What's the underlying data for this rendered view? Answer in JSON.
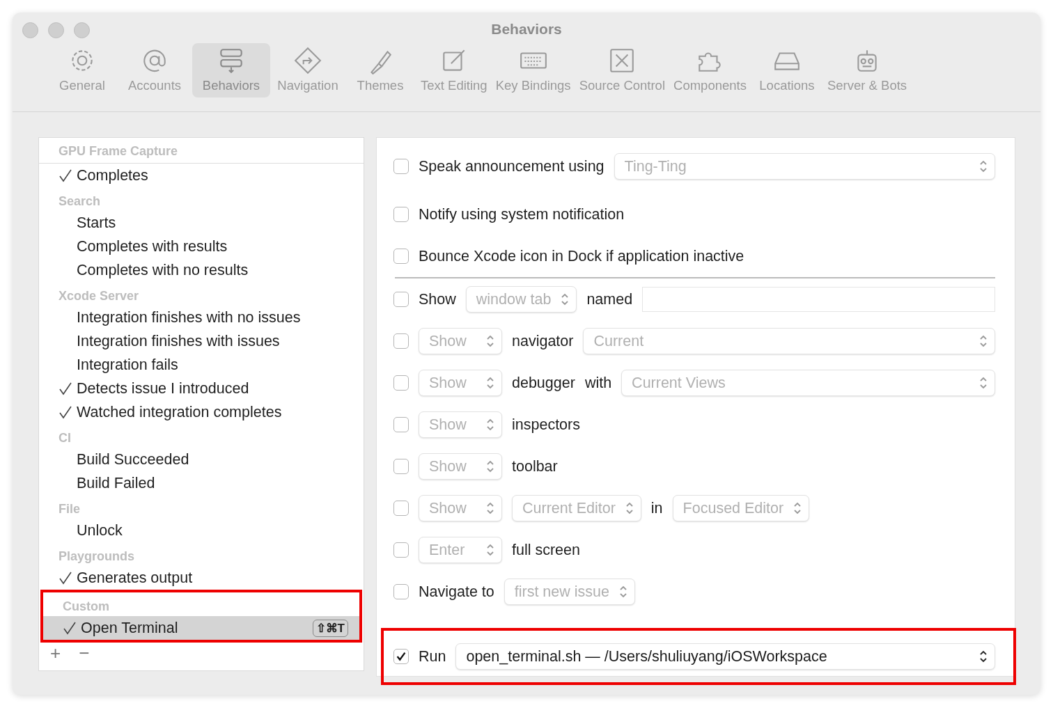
{
  "window": {
    "title": "Behaviors"
  },
  "toolbar": [
    {
      "label": "General",
      "selected": false
    },
    {
      "label": "Accounts",
      "selected": false
    },
    {
      "label": "Behaviors",
      "selected": true
    },
    {
      "label": "Navigation",
      "selected": false
    },
    {
      "label": "Themes",
      "selected": false
    },
    {
      "label": "Text Editing",
      "selected": false
    },
    {
      "label": "Key Bindings",
      "selected": false
    },
    {
      "label": "Source Control",
      "selected": false
    },
    {
      "label": "Components",
      "selected": false
    },
    {
      "label": "Locations",
      "selected": false
    },
    {
      "label": "Server & Bots",
      "selected": false
    }
  ],
  "sidebar": {
    "groups": [
      {
        "header": "GPU Frame Capture",
        "items": [
          {
            "label": "Completes",
            "checked": true,
            "selected": false
          }
        ]
      },
      {
        "header": "Search",
        "items": [
          {
            "label": "Starts",
            "checked": false,
            "selected": false
          },
          {
            "label": "Completes with results",
            "checked": false,
            "selected": false
          },
          {
            "label": "Completes with no results",
            "checked": false,
            "selected": false
          }
        ]
      },
      {
        "header": "Xcode Server",
        "items": [
          {
            "label": "Integration finishes with no issues",
            "checked": false,
            "selected": false
          },
          {
            "label": "Integration finishes with issues",
            "checked": false,
            "selected": false
          },
          {
            "label": "Integration fails",
            "checked": false,
            "selected": false
          },
          {
            "label": "Detects issue I introduced",
            "checked": true,
            "selected": false
          },
          {
            "label": "Watched integration completes",
            "checked": true,
            "selected": false
          }
        ]
      },
      {
        "header": "CI",
        "items": [
          {
            "label": "Build Succeeded",
            "checked": false,
            "selected": false
          },
          {
            "label": "Build Failed",
            "checked": false,
            "selected": false
          }
        ]
      },
      {
        "header": "File",
        "items": [
          {
            "label": "Unlock",
            "checked": false,
            "selected": false
          }
        ]
      },
      {
        "header": "Playgrounds",
        "items": [
          {
            "label": "Generates output",
            "checked": true,
            "selected": false
          }
        ]
      },
      {
        "header": "Custom",
        "highlighted": true,
        "items": [
          {
            "label": "Open Terminal",
            "checked": true,
            "selected": true,
            "shortcut": "⇧⌘T"
          }
        ]
      }
    ],
    "footer": [
      "+",
      "−"
    ]
  },
  "settings": {
    "rows": [
      {
        "checked": false,
        "parts": [
          {
            "kind": "label",
            "text": "Speak announcement using"
          },
          {
            "kind": "popup",
            "value": "Ting-Ting",
            "enabled": false,
            "wide": true
          }
        ]
      },
      {
        "checked": false,
        "parts": [
          {
            "kind": "label",
            "text": "Notify using system notification"
          }
        ]
      },
      {
        "checked": false,
        "divider_after": true,
        "parts": [
          {
            "kind": "label",
            "text": "Bounce Xcode icon in Dock if application inactive"
          }
        ]
      },
      {
        "checked": false,
        "parts": [
          {
            "kind": "label",
            "text": "Show"
          },
          {
            "kind": "popup",
            "value": "window tab",
            "enabled": false,
            "wide": false
          },
          {
            "kind": "label",
            "text": "named"
          },
          {
            "kind": "field"
          }
        ]
      },
      {
        "checked": false,
        "parts": [
          {
            "kind": "popup",
            "value": "Show",
            "enabled": false,
            "wide": false
          },
          {
            "kind": "label",
            "text": "navigator"
          },
          {
            "kind": "popup",
            "value": "Current",
            "enabled": false,
            "wide": true
          }
        ]
      },
      {
        "checked": false,
        "parts": [
          {
            "kind": "popup",
            "value": "Show",
            "enabled": false,
            "wide": false
          },
          {
            "kind": "label",
            "text": "debugger"
          },
          {
            "kind": "label",
            "text": "with"
          },
          {
            "kind": "popup",
            "value": "Current Views",
            "enabled": false,
            "wide": true
          }
        ]
      },
      {
        "checked": false,
        "parts": [
          {
            "kind": "popup",
            "value": "Show",
            "enabled": false,
            "wide": false
          },
          {
            "kind": "label",
            "text": "inspectors"
          }
        ]
      },
      {
        "checked": false,
        "parts": [
          {
            "kind": "popup",
            "value": "Show",
            "enabled": false,
            "wide": false
          },
          {
            "kind": "label",
            "text": "toolbar"
          }
        ]
      },
      {
        "checked": false,
        "parts": [
          {
            "kind": "popup",
            "value": "Show",
            "enabled": false,
            "wide": false
          },
          {
            "kind": "popup",
            "value": "Current Editor",
            "enabled": false,
            "wide": false
          },
          {
            "kind": "label",
            "text": "in"
          },
          {
            "kind": "popup",
            "value": "Focused Editor",
            "enabled": false,
            "wide": false
          }
        ]
      },
      {
        "checked": false,
        "parts": [
          {
            "kind": "popup",
            "value": "Enter",
            "enabled": false,
            "wide": false
          },
          {
            "kind": "label",
            "text": "full screen"
          }
        ]
      },
      {
        "checked": false,
        "parts": [
          {
            "kind": "label",
            "text": "Navigate to"
          },
          {
            "kind": "popup",
            "value": "first new issue",
            "enabled": false,
            "wide": false
          }
        ]
      },
      {
        "checked": true,
        "highlighted": true,
        "parts": [
          {
            "kind": "label",
            "text": "Run"
          },
          {
            "kind": "popup",
            "value": "open_terminal.sh — /Users/shuliuyang/iOSWorkspace",
            "enabled": true,
            "wide": true
          }
        ]
      }
    ]
  }
}
